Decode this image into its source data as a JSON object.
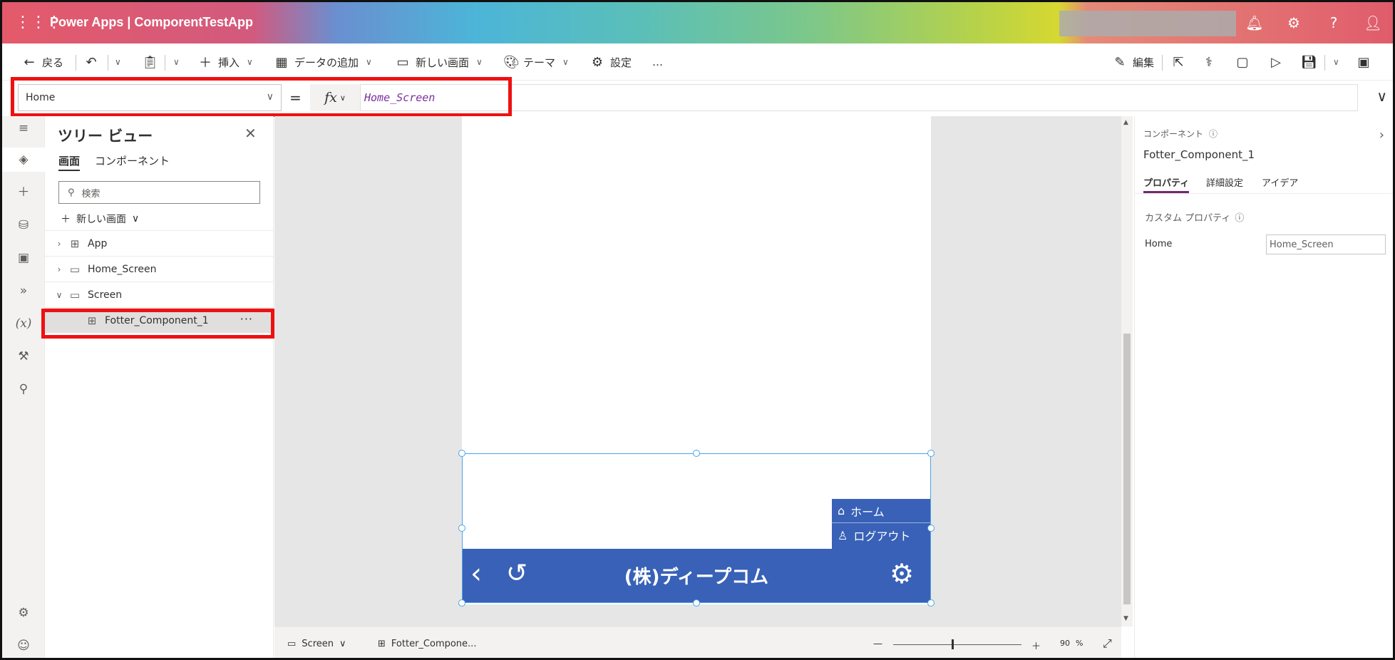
{
  "header": {
    "brand": "Power Apps  |  ComporentTestApp",
    "icons": [
      "bell-icon",
      "gear-icon",
      "help-icon",
      "user-icon"
    ]
  },
  "commandbar": {
    "back": "戻る",
    "insert": "挿入",
    "add_data": "データの追加",
    "new_screen": "新しい画面",
    "theme": "テーマ",
    "settings": "設定",
    "more": "…",
    "edit": "編集"
  },
  "formulabar": {
    "property": "Home",
    "equals": "=",
    "fx": "fx",
    "formula": "Home_Screen"
  },
  "treeview": {
    "title": "ツリー ビュー",
    "tabs": [
      "画面",
      "コンポーネント"
    ],
    "search_placeholder": "検索",
    "new_screen": "新しい画面",
    "items": [
      {
        "label": "App"
      },
      {
        "label": "Home_Screen"
      },
      {
        "label": "Screen"
      },
      {
        "label": "Fotter_Component_1"
      }
    ],
    "more": "···"
  },
  "canvas": {
    "menu": {
      "home": "ホーム",
      "logout": "ログアウト"
    },
    "company": "(株)ディープコム"
  },
  "statusbar": {
    "screen": "Screen",
    "component": "Fotter_Compone...",
    "zoom": "90",
    "zoom_unit": "%"
  },
  "properties": {
    "type": "コンポーネント",
    "name": "Fotter_Component_1",
    "tabs": [
      "プロパティ",
      "詳細設定",
      "アイデア"
    ],
    "custom_label": "カスタム プロパティ",
    "row_label": "Home",
    "row_value": "Home_Screen"
  },
  "colors": {
    "footer_blue": "#3861b7",
    "highlight_red": "#ee1111",
    "selection_blue": "#4ba3e8"
  }
}
